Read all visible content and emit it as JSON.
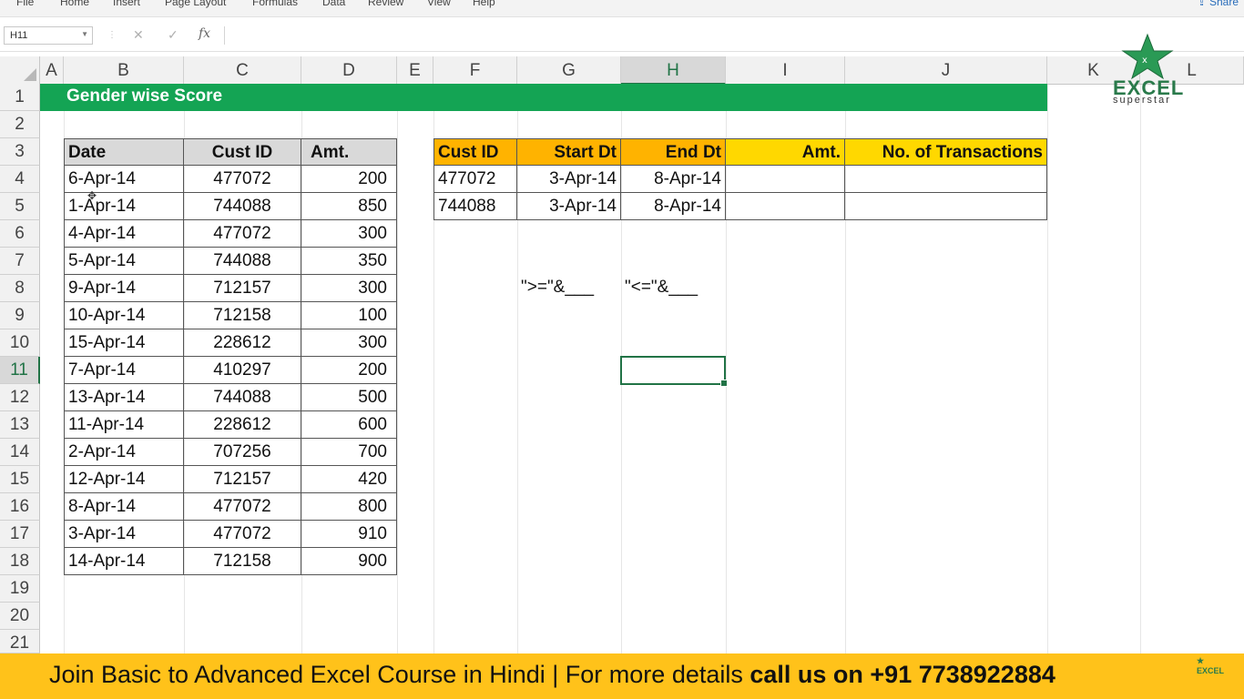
{
  "ribbon": {
    "tabs": [
      "File",
      "Home",
      "Insert",
      "Page Layout",
      "Formulas",
      "Data",
      "Review",
      "View",
      "Help"
    ],
    "share_label": "Share"
  },
  "formula_bar": {
    "name_box": "H11",
    "fx_label": "fx",
    "cancel_glyph": "✕",
    "enter_glyph": "✓",
    "formula": ""
  },
  "columns": [
    "A",
    "B",
    "C",
    "D",
    "E",
    "F",
    "G",
    "H",
    "I",
    "J",
    "K",
    "L"
  ],
  "rows": [
    "1",
    "2",
    "3",
    "4",
    "5",
    "6",
    "7",
    "8",
    "9",
    "10",
    "11",
    "12",
    "13",
    "14",
    "15",
    "16",
    "17",
    "18",
    "19",
    "20",
    "21"
  ],
  "selected_cell": "H11",
  "banner_title": "Gender wise Score",
  "logo": {
    "title": "EXCEL",
    "subtitle": "superstar"
  },
  "data_table": {
    "headers": [
      "Date",
      "Cust ID",
      "Amt."
    ],
    "rows": [
      [
        "6-Apr-14",
        "477072",
        "200"
      ],
      [
        "1-Apr-14",
        "744088",
        "850"
      ],
      [
        "4-Apr-14",
        "477072",
        "300"
      ],
      [
        "5-Apr-14",
        "744088",
        "350"
      ],
      [
        "9-Apr-14",
        "712157",
        "300"
      ],
      [
        "10-Apr-14",
        "712158",
        "100"
      ],
      [
        "15-Apr-14",
        "228612",
        "300"
      ],
      [
        "7-Apr-14",
        "410297",
        "200"
      ],
      [
        "13-Apr-14",
        "744088",
        "500"
      ],
      [
        "11-Apr-14",
        "228612",
        "600"
      ],
      [
        "2-Apr-14",
        "707256",
        "700"
      ],
      [
        "12-Apr-14",
        "712157",
        "420"
      ],
      [
        "8-Apr-14",
        "477072",
        "800"
      ],
      [
        "3-Apr-14",
        "477072",
        "910"
      ],
      [
        "14-Apr-14",
        "712158",
        "900"
      ]
    ]
  },
  "summary_table": {
    "headers": [
      "Cust ID",
      "Start Dt",
      "End Dt",
      "Amt.",
      "No. of Transactions"
    ],
    "rows": [
      [
        "477072",
        "3-Apr-14",
        "8-Apr-14",
        "",
        ""
      ],
      [
        "744088",
        "3-Apr-14",
        "8-Apr-14",
        "",
        ""
      ]
    ]
  },
  "criteria_hints": [
    ">=\"&___",
    "\"<=\"&___"
  ],
  "footer": {
    "text_plain": "Join Basic to Advanced Excel Course in Hindi | For more details ",
    "text_bold": "call us on +91 7738922884",
    "logo_text": "EXCEL"
  },
  "colors": {
    "banner_green": "#14a454",
    "header_orange": "#ffb300",
    "header_yellow": "#ffd800",
    "footer_yellow": "#ffc21a",
    "excel_green": "#217346"
  }
}
